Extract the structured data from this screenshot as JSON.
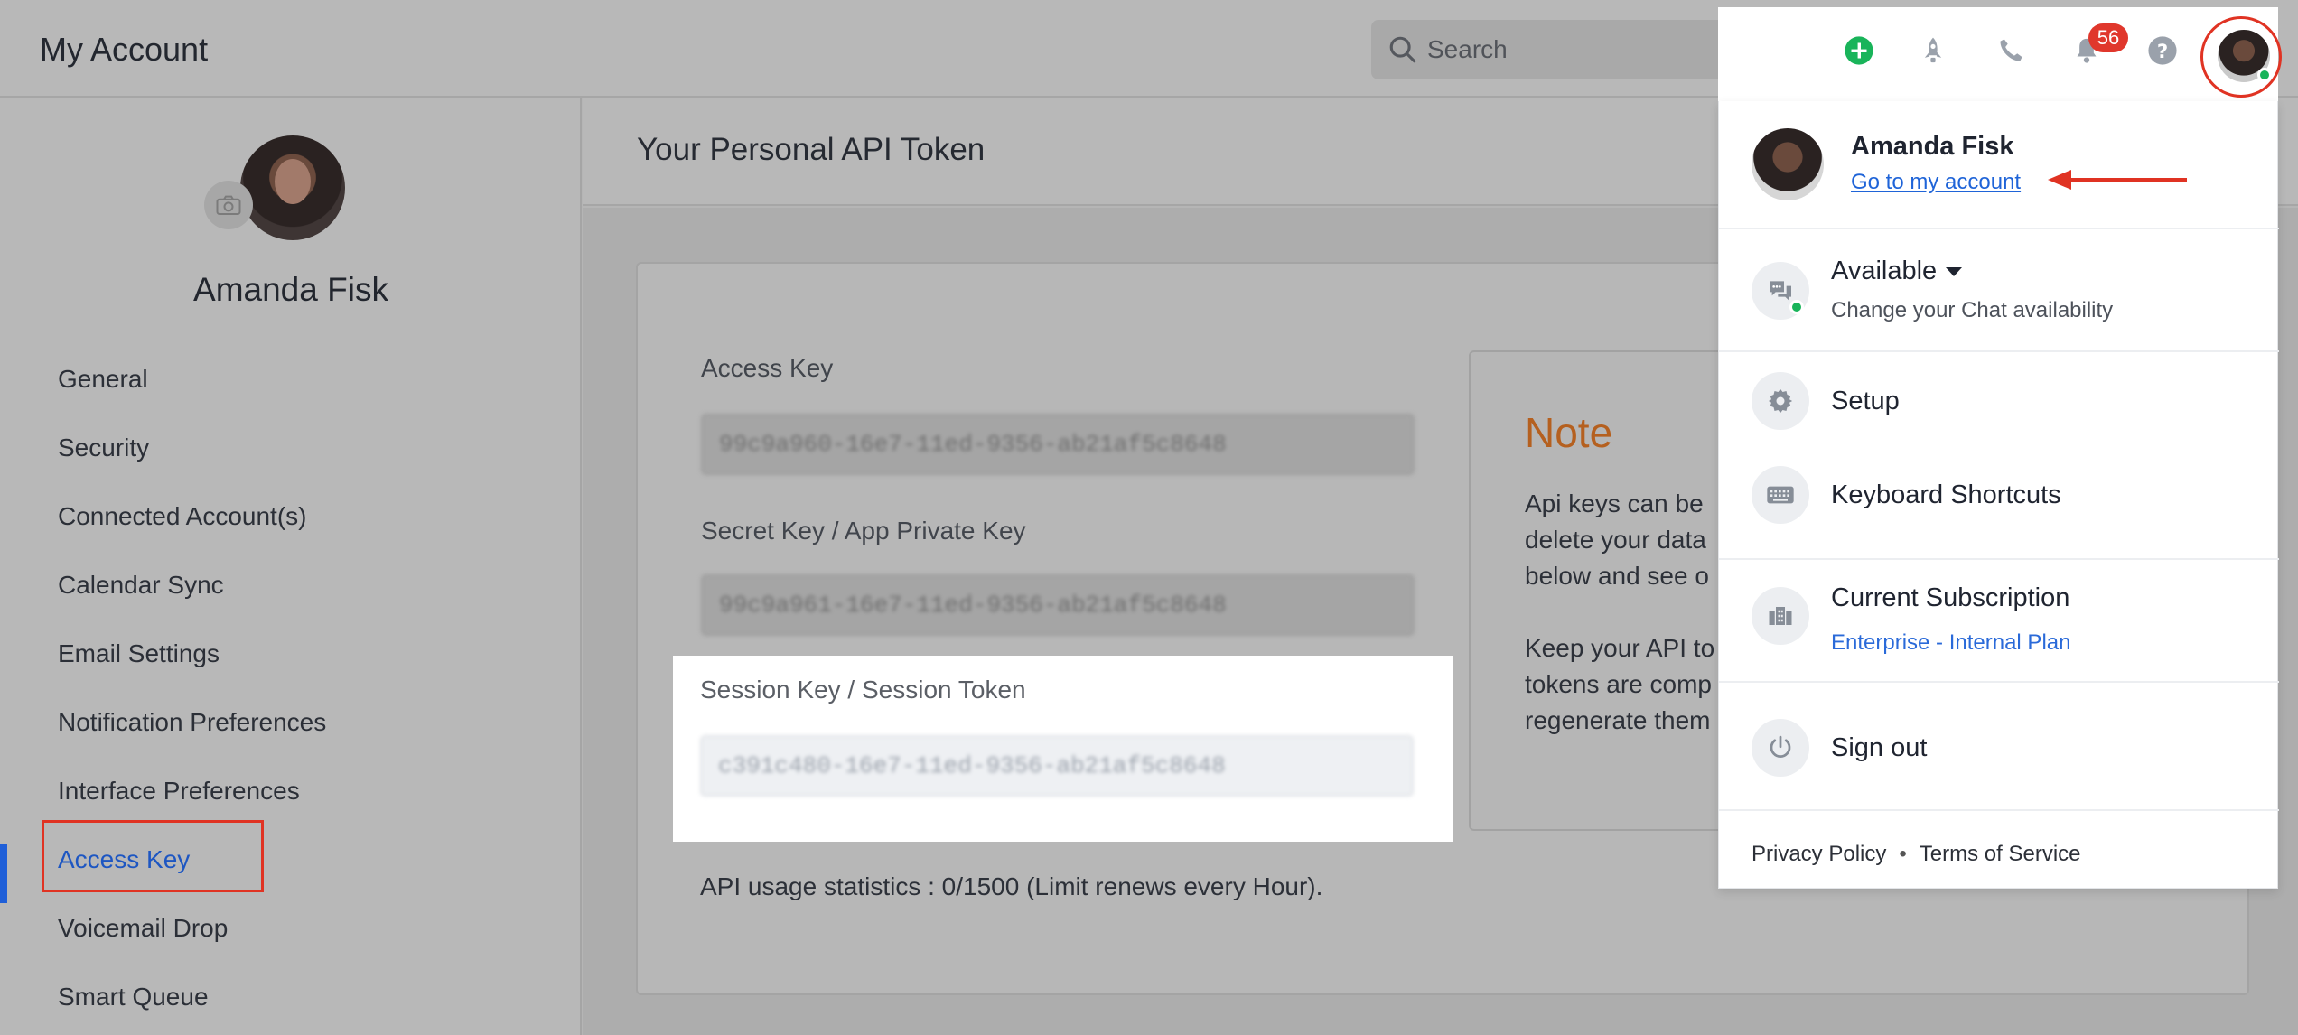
{
  "header": {
    "app_title": "My Account",
    "search_placeholder": "Search"
  },
  "sidebar": {
    "profile_name": "Amanda Fisk",
    "items": [
      {
        "label": "General"
      },
      {
        "label": "Security"
      },
      {
        "label": "Connected Account(s)"
      },
      {
        "label": "Calendar Sync"
      },
      {
        "label": "Email Settings"
      },
      {
        "label": "Notification Preferences"
      },
      {
        "label": "Interface Preferences"
      },
      {
        "label": "Access Key",
        "active": true
      },
      {
        "label": "Voicemail Drop"
      },
      {
        "label": "Smart Queue"
      }
    ]
  },
  "main": {
    "title": "Your Personal API Token",
    "access_key_label": "Access Key",
    "access_key_value": "99c9a960-16e7-11ed-9356-ab21af5c8648",
    "secret_key_label": "Secret Key / App Private Key",
    "secret_key_value": "99c9a961-16e7-11ed-9356-ab21af5c8648",
    "session_key_label": "Session Key / Session Token",
    "session_key_value": "c391c480-16e7-11ed-9356-ab21af5c8648",
    "usage": "API usage statistics : 0/1500 (Limit renews every Hour).",
    "note_title": "Note",
    "note_text": "Api keys can be\ndelete your data\nbelow and see o\n\nKeep your API to\ntokens are comp\nregenerate them"
  },
  "topbar_icons": {
    "notification_count": "56",
    "colors": {
      "add": "#19b45a",
      "badge": "#e0372c",
      "highlight": "#e03323"
    }
  },
  "dropdown": {
    "user_name": "Amanda Fisk",
    "account_link": "Go to my account",
    "availability_label": "Available",
    "availability_sub": "Change your Chat availability",
    "setup_label": "Setup",
    "shortcuts_label": "Keyboard Shortcuts",
    "subscription_label": "Current Subscription",
    "subscription_plan": "Enterprise - Internal Plan",
    "signout_label": "Sign out",
    "privacy_link": "Privacy Policy",
    "separator": "•",
    "terms_link": "Terms of Service"
  }
}
